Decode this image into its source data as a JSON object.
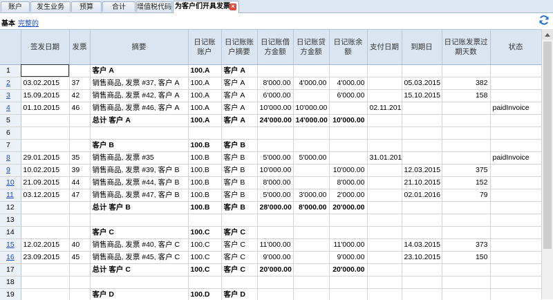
{
  "tabs": [
    {
      "label": "账户"
    },
    {
      "label": "发生业务"
    },
    {
      "label": "预算"
    },
    {
      "label": "合计"
    },
    {
      "label": "增值税代码"
    },
    {
      "label": "为客户们开具发票"
    }
  ],
  "subbar": {
    "basic": "基本",
    "complete": "完整的"
  },
  "columns": [
    "",
    "签发日期",
    "发票",
    "摘要",
    "日记账账户",
    "日记账账户摘要",
    "日记账借方金额",
    "日记账贷方金额",
    "日记账余额",
    "支付日期",
    "到期日",
    "日记账发票过期天数",
    "状态"
  ],
  "rows": [
    {
      "n": "1",
      "link": false,
      "bold": true,
      "cells": [
        "",
        "",
        "客户 A",
        "100.A",
        "客户 A",
        "",
        "",
        "",
        "",
        "",
        "",
        ""
      ]
    },
    {
      "n": "2",
      "link": true,
      "bold": false,
      "cells": [
        "03.02.2015",
        "37",
        "销售商品, 发票 #37, 客户 A",
        "100.A",
        "客户 A",
        "8'000.00",
        "4'000.00",
        "4'000.00",
        "",
        "05.03.2015",
        "382",
        ""
      ]
    },
    {
      "n": "3",
      "link": true,
      "bold": false,
      "cells": [
        "15.09.2015",
        "42",
        "销售商品, 发票 #42, 客户 A",
        "100.A",
        "客户 A",
        "6'000.00",
        "",
        "6'000.00",
        "",
        "15.10.2015",
        "158",
        ""
      ]
    },
    {
      "n": "4",
      "link": true,
      "bold": false,
      "cells": [
        "01.10.2015",
        "46",
        "销售商品, 发票 #46, 客户 A",
        "100.A",
        "客户 A",
        "10'000.00",
        "10'000.00",
        "",
        "02.11.201",
        "",
        "",
        "paidInvoice"
      ]
    },
    {
      "n": "5",
      "link": false,
      "bold": true,
      "cells": [
        "",
        "",
        "总计 客户 A",
        "100.A",
        "客户 A",
        "24'000.00",
        "14'000.00",
        "10'000.00",
        "",
        "",
        "",
        ""
      ]
    },
    {
      "n": "6",
      "link": false,
      "bold": false,
      "cells": [
        "",
        "",
        "",
        "",
        "",
        "",
        "",
        "",
        "",
        "",
        "",
        ""
      ]
    },
    {
      "n": "7",
      "link": false,
      "bold": true,
      "cells": [
        "",
        "",
        "客户 B",
        "100.B",
        "客户 B",
        "",
        "",
        "",
        "",
        "",
        "",
        ""
      ]
    },
    {
      "n": "8",
      "link": true,
      "bold": false,
      "cells": [
        "29.01.2015",
        "35",
        "销售商品, 发票 #35",
        "100.B",
        "客户 B",
        "5'000.00",
        "5'000.00",
        "",
        "31.01.201",
        "",
        "",
        "paidInvoice"
      ]
    },
    {
      "n": "9",
      "link": true,
      "bold": false,
      "cells": [
        "10.02.2015",
        "39",
        "销售商品, 发票 #39, 客户 B",
        "100.B",
        "客户 B",
        "10'000.00",
        "",
        "10'000.00",
        "",
        "12.03.2015",
        "375",
        ""
      ]
    },
    {
      "n": "10",
      "link": true,
      "bold": false,
      "cells": [
        "21.09.2015",
        "44",
        "销售商品, 发票 #44, 客户 B",
        "100.B",
        "客户 B",
        "8'000.00",
        "",
        "8'000.00",
        "",
        "21.10.2015",
        "152",
        ""
      ]
    },
    {
      "n": "11",
      "link": true,
      "bold": false,
      "cells": [
        "03.12.2015",
        "47",
        "销售商品, 发票 #47, 客户 B",
        "100.B",
        "客户 B",
        "5'000.00",
        "3'000.00",
        "2'000.00",
        "",
        "02.01.2016",
        "79",
        ""
      ]
    },
    {
      "n": "12",
      "link": false,
      "bold": true,
      "cells": [
        "",
        "",
        "总计 客户 B",
        "100.B",
        "客户 B",
        "28'000.00",
        "8'000.00",
        "20'000.00",
        "",
        "",
        "",
        ""
      ]
    },
    {
      "n": "13",
      "link": false,
      "bold": false,
      "cells": [
        "",
        "",
        "",
        "",
        "",
        "",
        "",
        "",
        "",
        "",
        "",
        ""
      ]
    },
    {
      "n": "14",
      "link": false,
      "bold": true,
      "cells": [
        "",
        "",
        "客户 C",
        "100.C",
        "客户 C",
        "",
        "",
        "",
        "",
        "",
        "",
        ""
      ]
    },
    {
      "n": "15",
      "link": true,
      "bold": false,
      "cells": [
        "12.02.2015",
        "40",
        "销售商品, 发票 #40, 客户 C",
        "100.C",
        "客户 C",
        "11'000.00",
        "",
        "11'000.00",
        "",
        "14.03.2015",
        "373",
        ""
      ]
    },
    {
      "n": "16",
      "link": true,
      "bold": false,
      "cells": [
        "23.09.2015",
        "45",
        "销售商品, 发票 #45, 客户 C",
        "100.C",
        "客户 C",
        "9'000.00",
        "",
        "9'000.00",
        "",
        "23.10.2015",
        "150",
        ""
      ]
    },
    {
      "n": "17",
      "link": false,
      "bold": true,
      "cells": [
        "",
        "",
        "总计 客户 C",
        "100.C",
        "客户 C",
        "20'000.00",
        "",
        "20'000.00",
        "",
        "",
        "",
        ""
      ]
    },
    {
      "n": "18",
      "link": false,
      "bold": false,
      "cells": [
        "",
        "",
        "",
        "",
        "",
        "",
        "",
        "",
        "",
        "",
        "",
        ""
      ]
    },
    {
      "n": "19",
      "link": false,
      "bold": true,
      "cells": [
        "",
        "",
        "客户 D",
        "100.D",
        "客户 D",
        "",
        "",
        "",
        "",
        "",
        "",
        ""
      ]
    }
  ]
}
